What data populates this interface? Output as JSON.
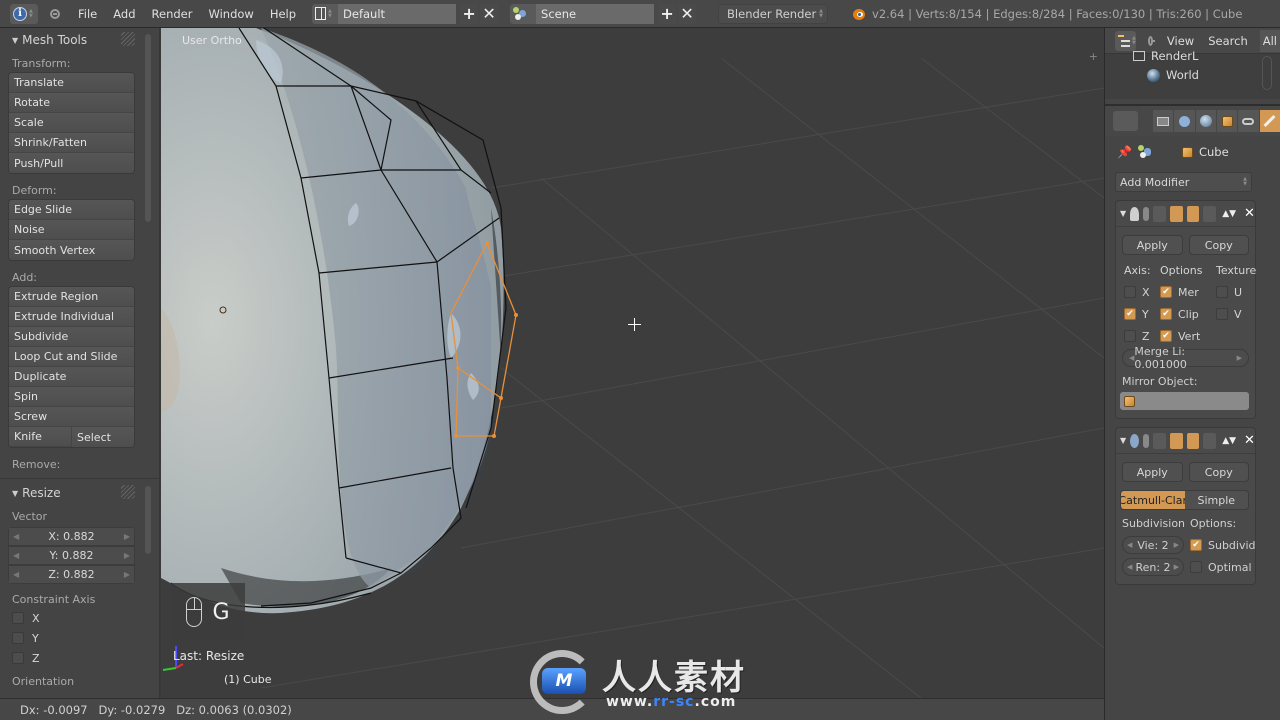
{
  "topbar": {
    "menus": [
      "File",
      "Add",
      "Render",
      "Window",
      "Help"
    ],
    "layout_name": "Default",
    "scene_name": "Scene",
    "render_engine": "Blender Render",
    "stats": "v2.64 | Verts:8/154 | Edges:8/284 | Faces:0/130 | Tris:260 | Cube",
    "icons": [
      "info-icon",
      "collapse-icon",
      "screen-layout-icon",
      "scene-icon",
      "blender-logo-icon"
    ]
  },
  "toolshelf": {
    "mesh_tools": {
      "title": "Mesh Tools",
      "transform_label": "Transform:",
      "transform": [
        "Translate",
        "Rotate",
        "Scale",
        "Shrink/Fatten",
        "Push/Pull"
      ],
      "deform_label": "Deform:",
      "deform": [
        "Edge Slide",
        "Noise",
        "Smooth Vertex"
      ],
      "add_label": "Add:",
      "add": [
        "Extrude Region",
        "Extrude Individual",
        "Subdivide",
        "Loop Cut and Slide",
        "Duplicate",
        "Spin",
        "Screw"
      ],
      "knife": "Knife",
      "select": "Select",
      "remove_label": "Remove:"
    },
    "resize": {
      "title": "Resize",
      "vector_label": "Vector",
      "x": "X: 0.882",
      "y": "Y: 0.882",
      "z": "Z: 0.882",
      "constraint_label": "Constraint Axis",
      "constraint_x": "X",
      "constraint_y": "Y",
      "constraint_z": "Z",
      "constraint_checked": [
        false,
        false,
        false
      ],
      "orientation_label": "Orientation"
    }
  },
  "viewport": {
    "view_label": "User Ortho",
    "key_pressed": "G",
    "last_operator": "Last: Resize",
    "object_label": "(1) Cube",
    "selection_color": "#e8903a",
    "wire_color": "#111111"
  },
  "statusbar": {
    "text": "Dx: -0.0097   Dy: -0.0279   Dz: 0.0063 (0.0302)"
  },
  "outliner": {
    "menus": [
      "View",
      "Search",
      "All"
    ],
    "items": [
      "RenderL",
      "World"
    ]
  },
  "properties": {
    "tabs": [
      "render-tab",
      "scene-tab",
      "world-tab",
      "object-tab",
      "constraints-tab",
      "modifiers-tab"
    ],
    "active_tab": "modifiers-tab",
    "context_object": "Cube",
    "add_modifier": "Add Modifier",
    "mirror": {
      "apply": "Apply",
      "copy": "Copy",
      "axis_label": "Axis:",
      "options_label": "Options",
      "texture_label": "Texture",
      "axis": [
        {
          "label": "X",
          "checked": false
        },
        {
          "label": "Y",
          "checked": true
        },
        {
          "label": "Z",
          "checked": false
        }
      ],
      "options": [
        {
          "label": "Mer",
          "checked": true
        },
        {
          "label": "Clip",
          "checked": true
        },
        {
          "label": "Vert",
          "checked": true
        }
      ],
      "texture": [
        {
          "label": "U",
          "checked": false
        },
        {
          "label": "V",
          "checked": false
        }
      ],
      "merge_limit": "Merge Li: 0.001000",
      "mirror_object_label": "Mirror Object:",
      "mirror_object_value": ""
    },
    "subsurf": {
      "apply": "Apply",
      "copy": "Copy",
      "type_catmull": "Catmull-Clar",
      "type_simple": "Simple",
      "active_type": "Catmull-Clar",
      "subdivision_label": "Subdivision",
      "options_label": "Options:",
      "view_levels": "Vie: 2",
      "render_levels": "Ren: 2",
      "subdivide_uvs": "Subdivid",
      "subdivide_uvs_checked": true,
      "optimal": "Optimal",
      "optimal_checked": false
    }
  },
  "watermark": {
    "title": "人人素材",
    "url_prefix": "www.",
    "url_mid": "rr-sc",
    "url_suffix": ".com",
    "logo_text": "M"
  }
}
